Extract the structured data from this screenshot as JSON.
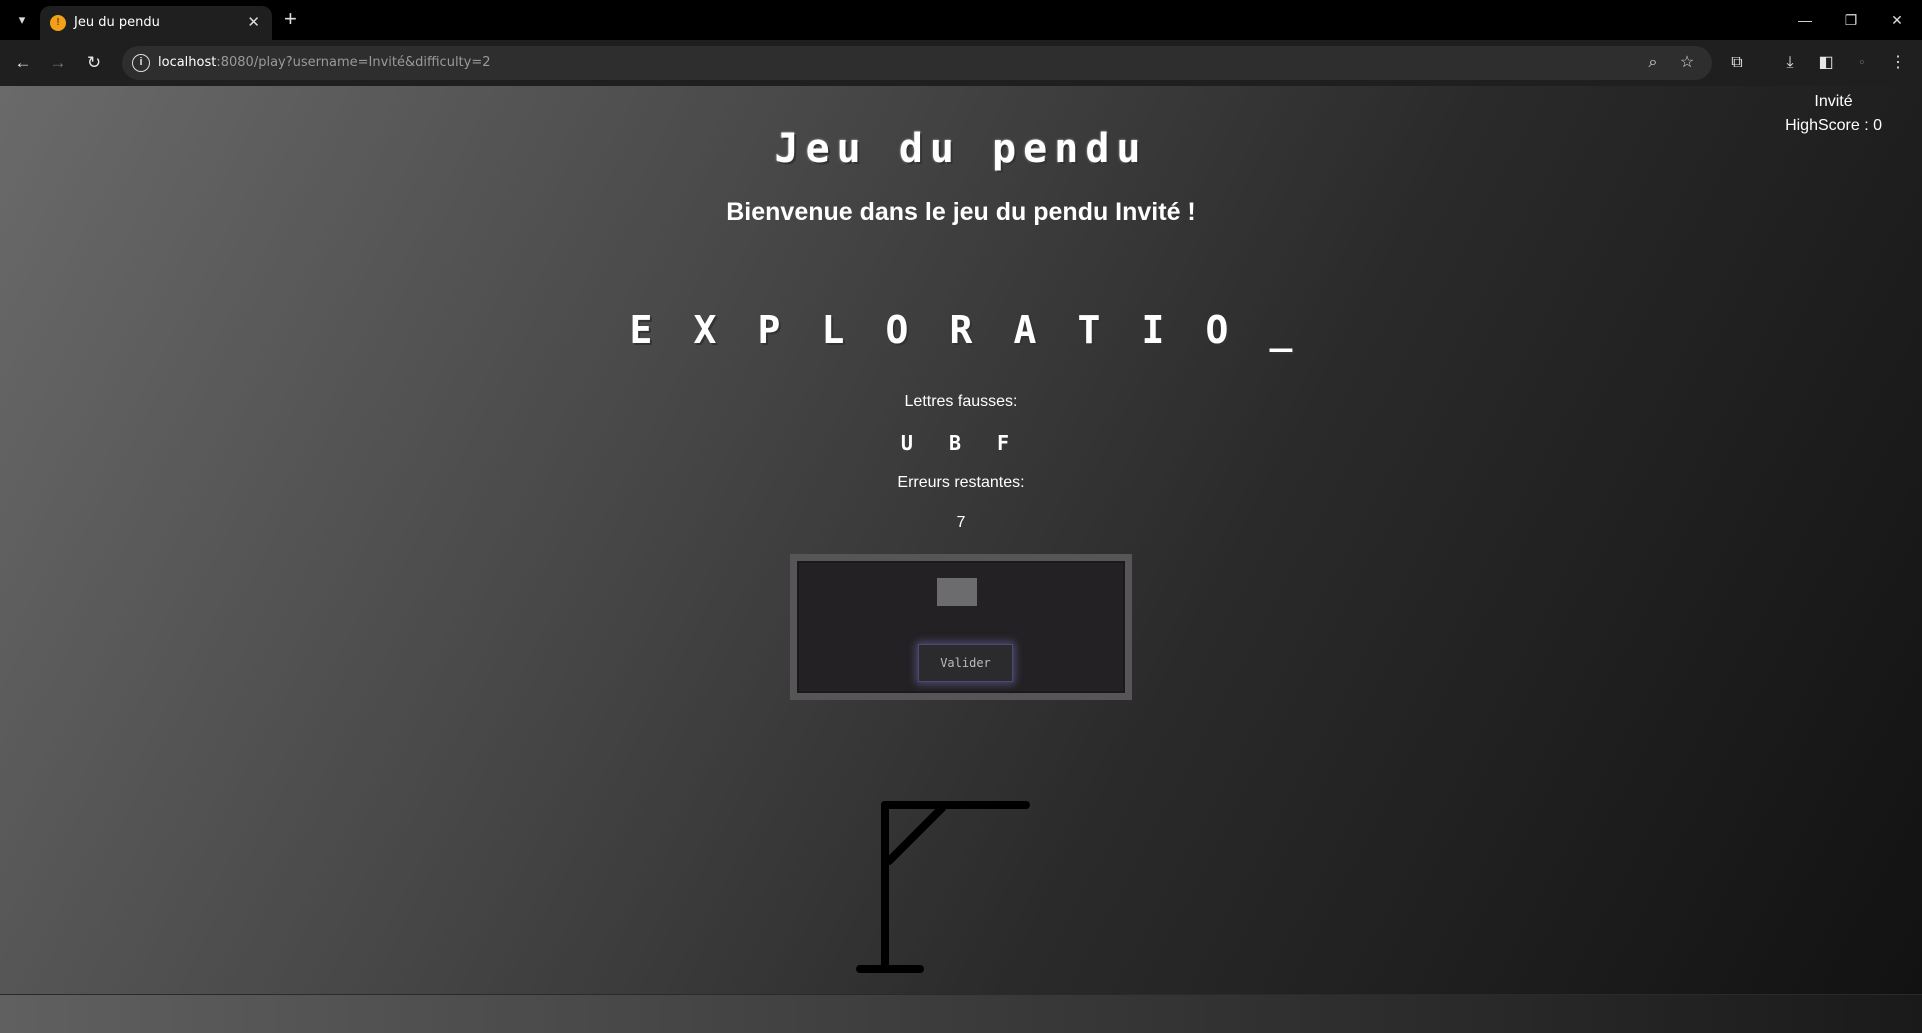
{
  "browser": {
    "tab_title": "Jeu du pendu",
    "url_host": "localhost",
    "url_rest": ":8080/play?username=Invité&difficulty=2"
  },
  "user": {
    "name": "Invité",
    "highscore": "HighScore : 0"
  },
  "game": {
    "title": "Jeu du pendu",
    "welcome": "Bienvenue dans le jeu du pendu Invité !",
    "word_letters": [
      "E",
      "X",
      "P",
      "L",
      "O",
      "R",
      "A",
      "T",
      "I",
      "O",
      "_"
    ],
    "wrong_letters_label": "Lettres fausses:",
    "wrong_letters": "U B F",
    "remaining_errors_label": "Erreurs restantes:",
    "remaining_errors": "7",
    "letter_input_value": "",
    "validate_label": "Valider"
  },
  "colors": {
    "page_gradient_light": "#6a6a6a",
    "page_gradient_dark": "#121212",
    "panel_bg": "#232123",
    "panel_border": "#575557",
    "button_glow": "#8282dc"
  }
}
